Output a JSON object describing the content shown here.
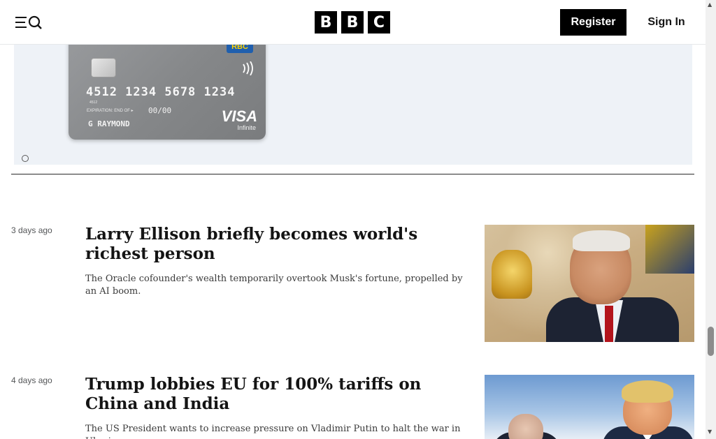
{
  "header": {
    "menu_icon": "menu-search-icon",
    "logo_letters": [
      "B",
      "B",
      "C"
    ],
    "register_label": "Register",
    "signin_label": "Sign In"
  },
  "ad": {
    "bank": "RBC",
    "card_number": "4512 1234 5678 1234",
    "card_small_number": "4512",
    "expiry_label": "EXPIRATION: END OF ▸",
    "expiry_value": "00/00",
    "cardholder": "G RAYMOND",
    "network": "VISA",
    "network_tier": "Infinite",
    "contactless_icon": "contactless-icon"
  },
  "articles": [
    {
      "timestamp": "3 days ago",
      "headline": "Larry Ellison briefly becomes world's richest person",
      "summary": "The Oracle cofounder's wealth temporarily overtook Musk's fortune, propelled by an AI boom."
    },
    {
      "timestamp": "4 days ago",
      "headline": "Trump lobbies EU for 100% tariffs on China and India",
      "summary": "The US President wants to increase pressure on Vladimir Putin to halt the war in Ukraine."
    }
  ],
  "colors": {
    "header_bg": "#ffffff",
    "button_bg": "#000000",
    "ad_bg": "#eef2f7",
    "text": "#141414",
    "muted": "#545658"
  },
  "scrollbar": {
    "position_fraction": 0.76
  }
}
